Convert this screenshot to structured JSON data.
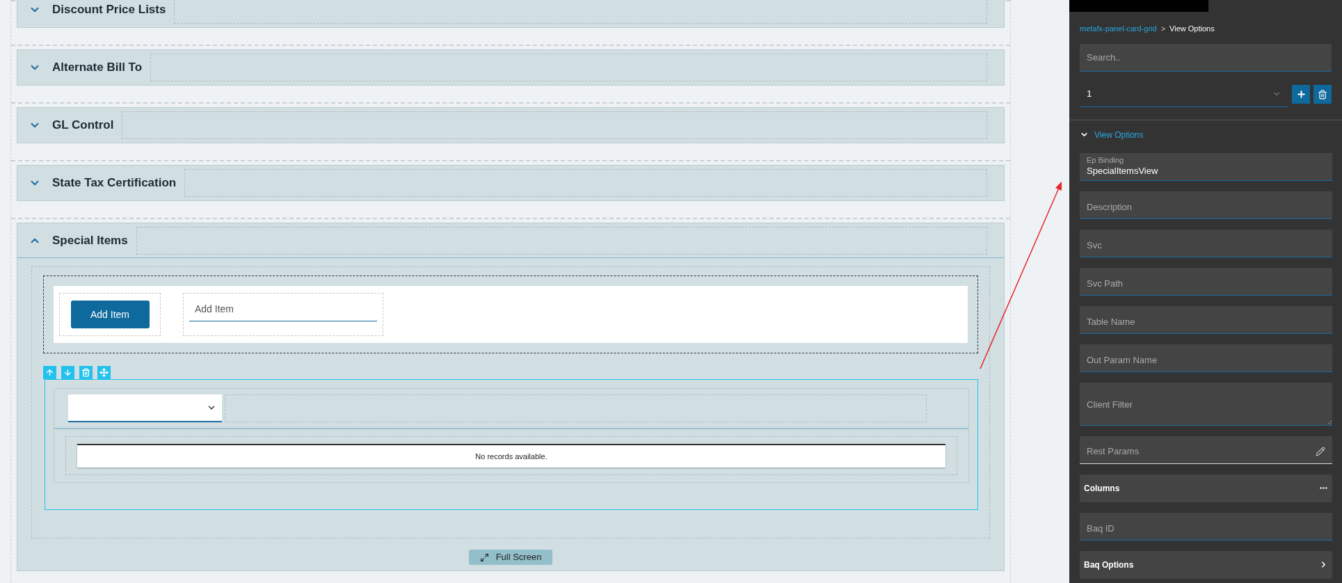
{
  "sections": [
    {
      "title": "Discount Price Lists",
      "expanded": false
    },
    {
      "title": "Alternate Bill To",
      "expanded": false
    },
    {
      "title": "GL Control",
      "expanded": false
    },
    {
      "title": "State Tax Certification",
      "expanded": false
    },
    {
      "title": "Special Items",
      "expanded": true
    }
  ],
  "special_items": {
    "add_button": "Add Item",
    "add_field": {
      "placeholder": "Add Item"
    },
    "grid_empty": "No records available.",
    "full_screen": "Full Screen"
  },
  "properties": {
    "breadcrumb": {
      "parent": "metafx-panel-card-grid",
      "separator": ">",
      "current": "View Options"
    },
    "search": {
      "placeholder": "Search.."
    },
    "select": {
      "value": "1"
    },
    "group": {
      "title": "View Options",
      "expanded": true
    },
    "fields": [
      {
        "kind": "floating",
        "label": "Ep Binding",
        "value": "SpecialItemsView"
      },
      {
        "kind": "input",
        "placeholder": "Description"
      },
      {
        "kind": "input",
        "placeholder": "Svc"
      },
      {
        "kind": "input",
        "placeholder": "Svc Path"
      },
      {
        "kind": "input",
        "placeholder": "Table Name"
      },
      {
        "kind": "input",
        "placeholder": "Out Param Name"
      },
      {
        "kind": "textarea",
        "placeholder": "Client Filter"
      },
      {
        "kind": "editor",
        "placeholder": "Rest Params"
      },
      {
        "kind": "menu",
        "label": "Columns"
      },
      {
        "kind": "input",
        "placeholder": "Baq ID"
      },
      {
        "kind": "link",
        "label": "Baq Options"
      }
    ]
  }
}
